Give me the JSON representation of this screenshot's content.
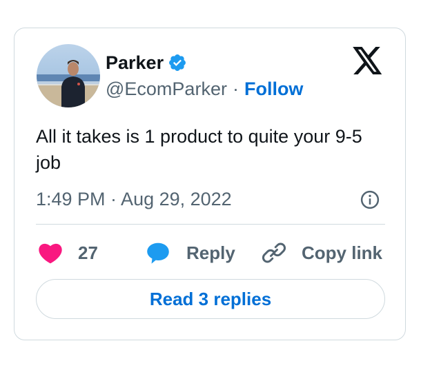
{
  "author": {
    "name": "Parker",
    "handle": "@EcomParker",
    "separator": "·",
    "follow_label": "Follow"
  },
  "tweet": {
    "text": "All it takes is 1 product to quite your 9-5 job",
    "timestamp": "1:49 PM · Aug 29, 2022"
  },
  "actions": {
    "like_count": "27",
    "reply_label": "Reply",
    "copy_label": "Copy link"
  },
  "read_replies_label": "Read 3 replies",
  "icons": {
    "brand": "x-logo-icon",
    "verified": "verified-badge-icon",
    "info": "info-icon",
    "like": "heart-icon",
    "reply": "speech-bubble-icon",
    "copy": "link-icon"
  },
  "colors": {
    "accent": "#006fd6",
    "verified": "#1d9bf0",
    "like": "#f91880",
    "text_secondary": "#536471",
    "border": "#cfd9de"
  }
}
